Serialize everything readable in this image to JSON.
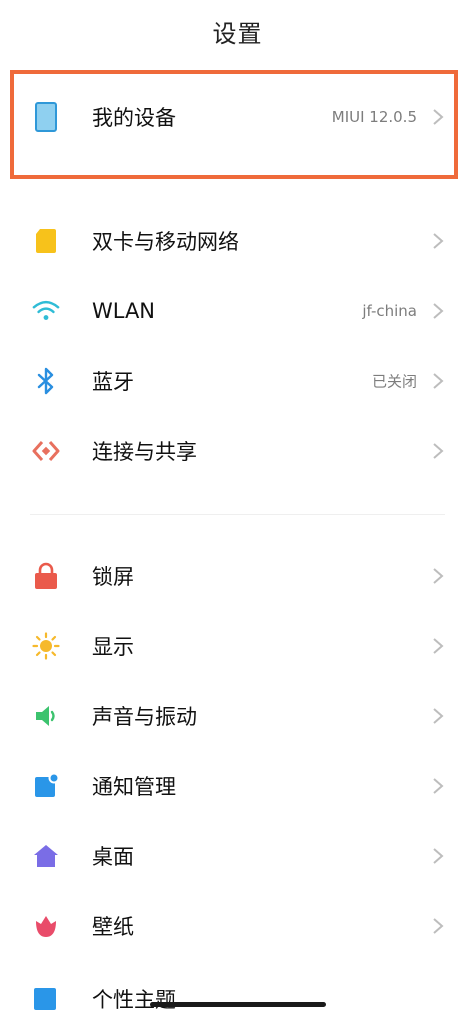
{
  "header": {
    "title": "设置"
  },
  "colors": {
    "highlight_border": "#ef6a3a"
  },
  "device": {
    "label": "我的设备",
    "value": "MIUI 12.0.5",
    "icon": "tablet-icon"
  },
  "network": [
    {
      "label": "双卡与移动网络",
      "value": "",
      "icon": "sim-card-icon"
    },
    {
      "label": "WLAN",
      "value": "jf-china",
      "icon": "wifi-icon"
    },
    {
      "label": "蓝牙",
      "value": "已关闭",
      "icon": "bluetooth-icon"
    },
    {
      "label": "连接与共享",
      "value": "",
      "icon": "connection-share-icon"
    }
  ],
  "system": [
    {
      "label": "锁屏",
      "icon": "lock-icon"
    },
    {
      "label": "显示",
      "icon": "sun-icon"
    },
    {
      "label": "声音与振动",
      "icon": "speaker-icon"
    },
    {
      "label": "通知管理",
      "icon": "notification-icon"
    },
    {
      "label": "桌面",
      "icon": "home-icon"
    },
    {
      "label": "壁纸",
      "icon": "flower-icon"
    },
    {
      "label": "个性主题",
      "icon": "theme-icon"
    }
  ]
}
